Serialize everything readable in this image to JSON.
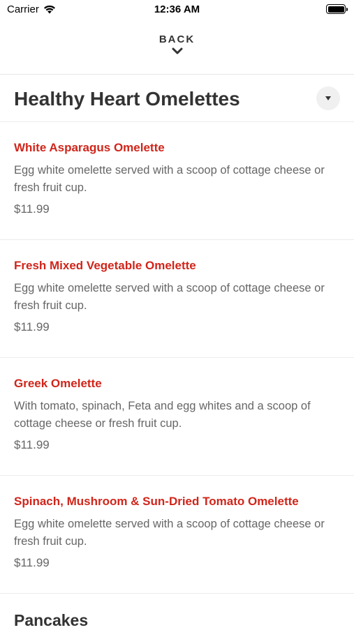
{
  "status_bar": {
    "carrier": "Carrier",
    "time": "12:36 AM"
  },
  "nav": {
    "back_label": "BACK"
  },
  "section": {
    "title": "Healthy Heart Omelettes",
    "toggle_icon": "caret-down-icon"
  },
  "items": [
    {
      "name": "White Asparagus Omelette",
      "description": "Egg white omelette served with a scoop of cottage cheese or fresh fruit cup.",
      "price": "$11.99"
    },
    {
      "name": "Fresh Mixed Vegetable Omelette",
      "description": "Egg white omelette served with a scoop of cottage cheese or fresh fruit cup.",
      "price": "$11.99"
    },
    {
      "name": "Greek Omelette",
      "description": "With tomato, spinach, Feta and egg whites and a scoop of cottage cheese or fresh fruit cup.",
      "price": "$11.99"
    },
    {
      "name": "Spinach, Mushroom & Sun-Dried Tomato Omelette",
      "description": "Egg white omelette served with a scoop of cottage cheese or fresh fruit cup.",
      "price": "$11.99"
    }
  ],
  "next_section": {
    "title": "Pancakes"
  },
  "colors": {
    "accent": "#d0251a",
    "text": "#333333",
    "muted": "#666666"
  }
}
